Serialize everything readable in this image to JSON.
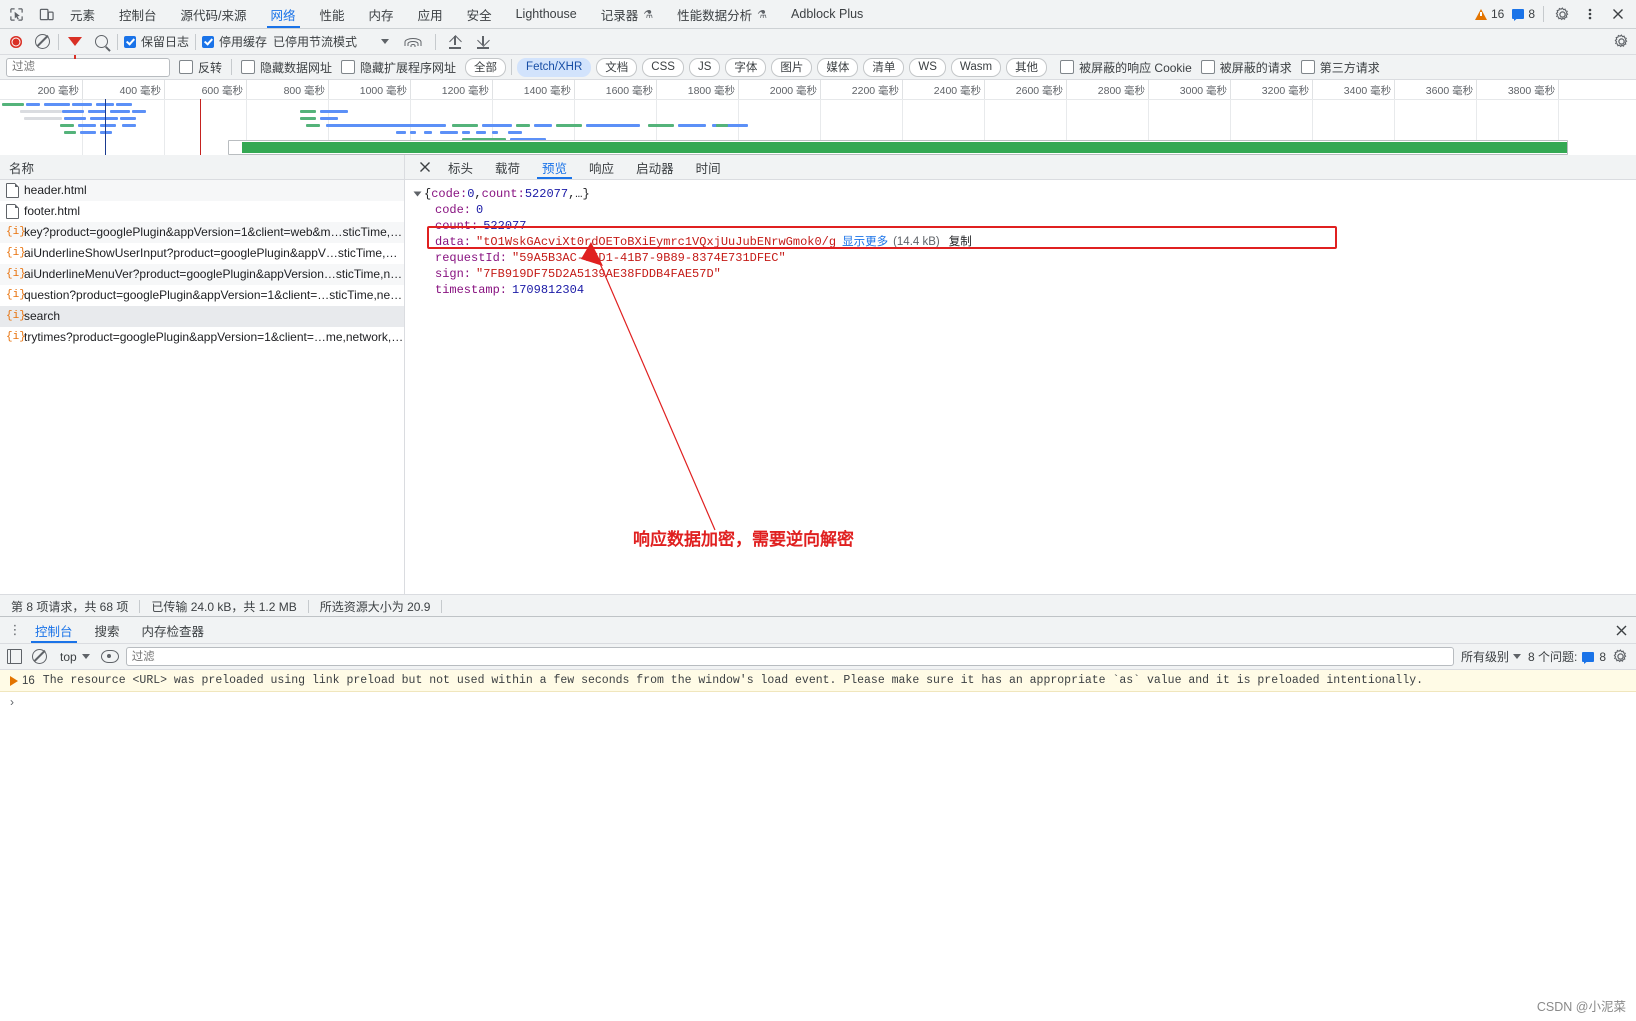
{
  "tabbar": {
    "inspect_icon": "inspect-icon",
    "device_icon": "device-toolbar-icon",
    "tabs": [
      {
        "label": "元素",
        "selected": false,
        "beta": false
      },
      {
        "label": "控制台",
        "selected": false,
        "beta": false
      },
      {
        "label": "源代码/来源",
        "selected": false,
        "beta": false
      },
      {
        "label": "网络",
        "selected": true,
        "beta": false
      },
      {
        "label": "性能",
        "selected": false,
        "beta": false
      },
      {
        "label": "内存",
        "selected": false,
        "beta": false
      },
      {
        "label": "应用",
        "selected": false,
        "beta": false
      },
      {
        "label": "安全",
        "selected": false,
        "beta": false
      },
      {
        "label": "Lighthouse",
        "selected": false,
        "beta": false
      },
      {
        "label": "记录器",
        "selected": false,
        "beta": true
      },
      {
        "label": "性能数据分析",
        "selected": false,
        "beta": true
      },
      {
        "label": "Adblock Plus",
        "selected": false,
        "beta": false
      }
    ],
    "warning_count": "16",
    "message_count": "8",
    "settings_icon": "gear-icon",
    "more_icon": "more-vertical-icon",
    "close_icon": "close-icon"
  },
  "nettoolbar": {
    "record_icon": "record-icon",
    "clear_icon": "clear-icon",
    "filter_icon": "filter-icon",
    "search_icon": "search-icon",
    "preserve_log_label": "保留日志",
    "preserve_log_checked": true,
    "disable_cache_label": "停用缓存",
    "disable_cache_checked": true,
    "throttle_label": "已停用节流模式",
    "wifi_icon": "network-conditions-icon",
    "import_icon": "import-har-icon",
    "export_icon": "export-har-icon",
    "settings_icon": "gear-icon"
  },
  "filterrow": {
    "filter_placeholder": "过滤",
    "filter_value": "",
    "invert_label": "反转",
    "invert_checked": false,
    "hide_data_urls_label": "隐藏数据网址",
    "hide_data_urls_checked": false,
    "hide_ext_urls_label": "隐藏扩展程序网址",
    "hide_ext_urls_checked": false,
    "types": [
      {
        "label": "全部",
        "selected": false
      },
      {
        "label": "Fetch/XHR",
        "selected": true
      },
      {
        "label": "文档",
        "selected": false
      },
      {
        "label": "CSS",
        "selected": false
      },
      {
        "label": "JS",
        "selected": false
      },
      {
        "label": "字体",
        "selected": false
      },
      {
        "label": "图片",
        "selected": false
      },
      {
        "label": "媒体",
        "selected": false
      },
      {
        "label": "清单",
        "selected": false
      },
      {
        "label": "WS",
        "selected": false
      },
      {
        "label": "Wasm",
        "selected": false
      },
      {
        "label": "其他",
        "selected": false
      }
    ],
    "blocked_cookies_label": "被屏蔽的响应 Cookie",
    "blocked_cookies_checked": false,
    "blocked_requests_label": "被屏蔽的请求",
    "blocked_requests_checked": false,
    "third_party_label": "第三方请求",
    "third_party_checked": false
  },
  "overview": {
    "tick_labels": [
      "200 毫秒",
      "400 毫秒",
      "600 毫秒",
      "800 毫秒",
      "1000 毫秒",
      "1200 毫秒",
      "1400 毫秒",
      "1600 毫秒",
      "1800 毫秒",
      "2000 毫秒",
      "2200 毫秒",
      "2400 毫秒",
      "2600 毫秒",
      "2800 毫秒",
      "3000 毫秒",
      "3200 毫秒",
      "3400 毫秒",
      "3600 毫秒",
      "3800 毫秒"
    ],
    "dom_content_loaded_color": "#1a3a8f",
    "load_event_color": "#c5221f",
    "selection_color": "#34a853"
  },
  "requests": {
    "column_header": "名称",
    "rows": [
      {
        "name": "header.html",
        "icon": "document-icon",
        "selected": false
      },
      {
        "name": "footer.html",
        "icon": "document-icon",
        "selected": false
      },
      {
        "name": "key?product=googlePlugin&appVersion=1&client=web&m…sticTime,ne…",
        "icon": "xhr-icon",
        "selected": false
      },
      {
        "name": "aiUnderlineShowUserInput?product=googlePlugin&appV…sticTime,netw…",
        "icon": "xhr-icon",
        "selected": false
      },
      {
        "name": "aiUnderlineMenuVer?product=googlePlugin&appVersion…sticTime,netw…",
        "icon": "xhr-icon",
        "selected": false
      },
      {
        "name": "question?product=googlePlugin&appVersion=1&client=…sticTime,netw…",
        "icon": "xhr-icon",
        "selected": false
      },
      {
        "name": "search",
        "icon": "xhr-icon",
        "selected": true
      },
      {
        "name": "trytimes?product=googlePlugin&appVersion=1&client=…me,network,pr…",
        "icon": "xhr-icon",
        "selected": false
      }
    ]
  },
  "detail": {
    "close_icon": "close-icon",
    "tabs": [
      {
        "label": "标头",
        "selected": false
      },
      {
        "label": "载荷",
        "selected": false
      },
      {
        "label": "预览",
        "selected": true
      },
      {
        "label": "响应",
        "selected": false
      },
      {
        "label": "启动器",
        "selected": false
      },
      {
        "label": "时间",
        "selected": false
      }
    ],
    "preview": {
      "root_summary_open": "{",
      "root_summary_key1": "code: ",
      "root_summary_val1": "0",
      "root_summary_sep": ", ",
      "root_summary_key2": "count: ",
      "root_summary_val2": "522077",
      "root_summary_tail": ",…}",
      "fields": [
        {
          "key": "code:",
          "value": "0",
          "type": "num"
        },
        {
          "key": "count:",
          "value": "522077",
          "type": "num"
        },
        {
          "key": "data:",
          "value": "\"tO1WskGAcviXt0rdOEToBXiEymrc1VQxjUuJubENrwGmok0/g",
          "type": "str",
          "show_more": "显示更多",
          "size": "(14.4 kB)",
          "copy": "复制"
        },
        {
          "key": "requestId:",
          "value": "\"59A5B3AC-75D1-41B7-9B89-8374E731DFEC\"",
          "type": "str"
        },
        {
          "key": "sign:",
          "value": "\"7FB919DF75D2A5139AE38FDDB4FAE57D\"",
          "type": "str"
        },
        {
          "key": "timestamp:",
          "value": "1709812304",
          "type": "num"
        }
      ]
    },
    "annotation": "响应数据加密，需要逆向解密",
    "annotation_color": "#e02020"
  },
  "netstatus": {
    "requests_text": "第 8 项请求，共 68 项",
    "transfer_text": "已传输 24.0 kB，共 1.2 MB",
    "resources_text": "所选资源大小为 20.9"
  },
  "drawer": {
    "more_icon": "more-vertical-icon",
    "tabs": [
      {
        "label": "控制台",
        "selected": true
      },
      {
        "label": "搜索",
        "selected": false
      },
      {
        "label": "内存检查器",
        "selected": false
      }
    ],
    "close_icon": "close-icon",
    "sidebar_icon": "console-sidebar-icon",
    "clear_icon": "clear-console-icon",
    "context": "top",
    "eye_icon": "live-expression-icon",
    "filter_placeholder": "过滤",
    "filter_value": "",
    "levels_label": "所有级别",
    "issues_label": "8 个问题:",
    "issues_count": "8",
    "message_count": "16",
    "message_text": "The resource <URL> was preloaded using link preload but not used within a few seconds from the window's load event. Please make sure it has an appropriate `as` value and it is preloaded intentionally.",
    "prompt_symbol": "›"
  },
  "watermark": "CSDN @小泥菜"
}
